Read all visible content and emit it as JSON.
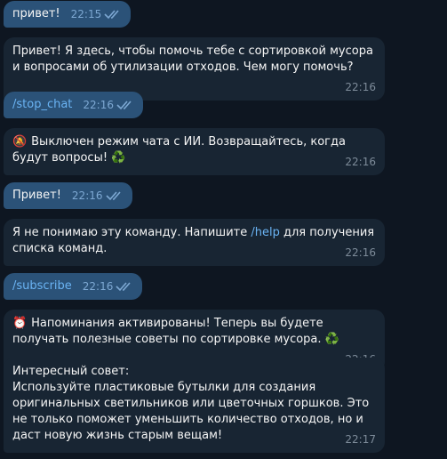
{
  "messages": [
    {
      "id": "m1",
      "dir": "out",
      "text": "привет!",
      "time": "22:15"
    },
    {
      "id": "m2",
      "dir": "in",
      "text": "Привет! Я здесь, чтобы помочь тебе с сортировкой мусора и вопросами об утилизации отходов. Чем могу помочь?",
      "time": "22:16"
    },
    {
      "id": "m3",
      "dir": "out",
      "text": "/stop_chat",
      "time": "22:16"
    },
    {
      "id": "m4",
      "dir": "in",
      "emoji": "🔕",
      "text": "Выключен режим чата с ИИ. Возвращайтесь, когда будут вопросы!",
      "trailing": "♻️",
      "time": "22:16"
    },
    {
      "id": "m5",
      "dir": "out",
      "text": "Привет!",
      "time": "22:16"
    },
    {
      "id": "m6",
      "dir": "in",
      "text_before": "Я не понимаю эту команду. Напишите ",
      "link": "/help",
      "text_after": " для получения списка команд.",
      "time": "22:16"
    },
    {
      "id": "m7",
      "dir": "out",
      "text": "/subscribe",
      "time": "22:16"
    },
    {
      "id": "m8",
      "dir": "in",
      "emoji": "⏰",
      "text": "Напоминания активированы! Теперь вы будете получать полезные советы по сортировке мусора.",
      "trailing": "♻️",
      "time": "22:16"
    },
    {
      "id": "m9",
      "dir": "in",
      "text": "Интересный совет:\nИспользуйте пластиковые бутылки для создания оригинальных светильников или цветочных горшков. Это не только поможет уменьшить количество отходов, но и даст новую жизнь старым вещам!",
      "time": "22:17"
    }
  ],
  "icons": {
    "read_receipt": "double-check-icon",
    "muted": "bell-muted-icon",
    "alarm": "alarm-clock-icon",
    "recycle": "recycle-icon"
  },
  "colors": {
    "background": "#0e1621",
    "outgoing": "#2b5278",
    "incoming": "#182533",
    "link": "#6ab3f3"
  }
}
